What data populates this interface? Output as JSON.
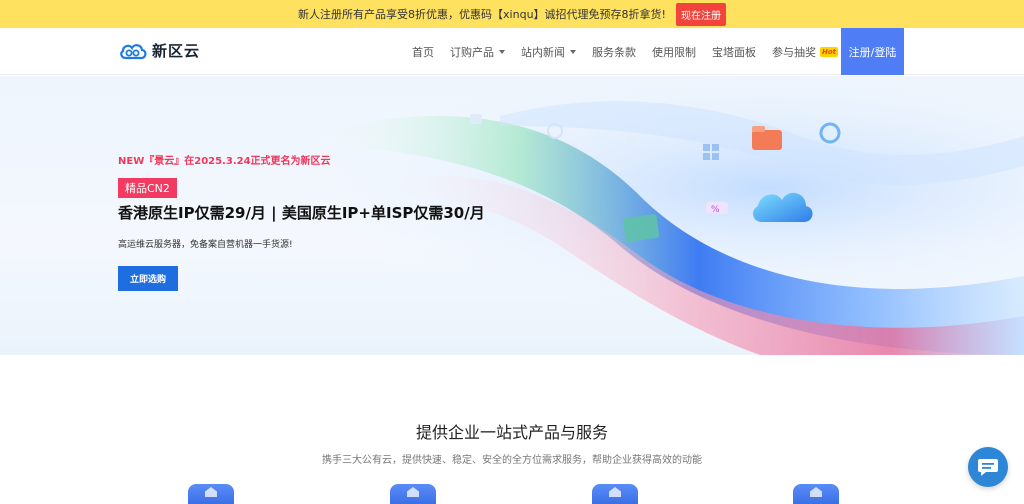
{
  "promo": {
    "text": "新人注册所有产品享受8折优惠，优惠码【xinqu】诚招代理免预存8折拿货!",
    "button": "现在注册"
  },
  "header": {
    "logo_text": "新区云",
    "nav": [
      {
        "label": "首页"
      },
      {
        "label": "订购产品"
      },
      {
        "label": "站内新闻"
      },
      {
        "label": "服务条款"
      },
      {
        "label": "使用限制"
      },
      {
        "label": "宝塔面板"
      },
      {
        "label": "参与抽奖"
      }
    ],
    "hot_badge": "Hot",
    "login_button": "注册/登陆"
  },
  "hero": {
    "tag": "NEW『景云』在2025.3.24正式更名为新区云",
    "badge": "精品CN2",
    "title": "香港原生IP仅需29/月 | 美国原生IP+单ISP仅需30/月",
    "subtitle": "高运维云服务器，免备案自营机器一手货源!",
    "button": "立即选购"
  },
  "section": {
    "title": "提供企业一站式产品与服务",
    "subtitle": "携手三大公有云，提供快速、稳定、安全的全方位需求服务，帮助企业获得高效的动能"
  },
  "colors": {
    "promo_bg": "#fde15f",
    "accent": "#4f7df6",
    "primary_button": "#1f6ee0",
    "highlight_red": "#f23b62"
  }
}
